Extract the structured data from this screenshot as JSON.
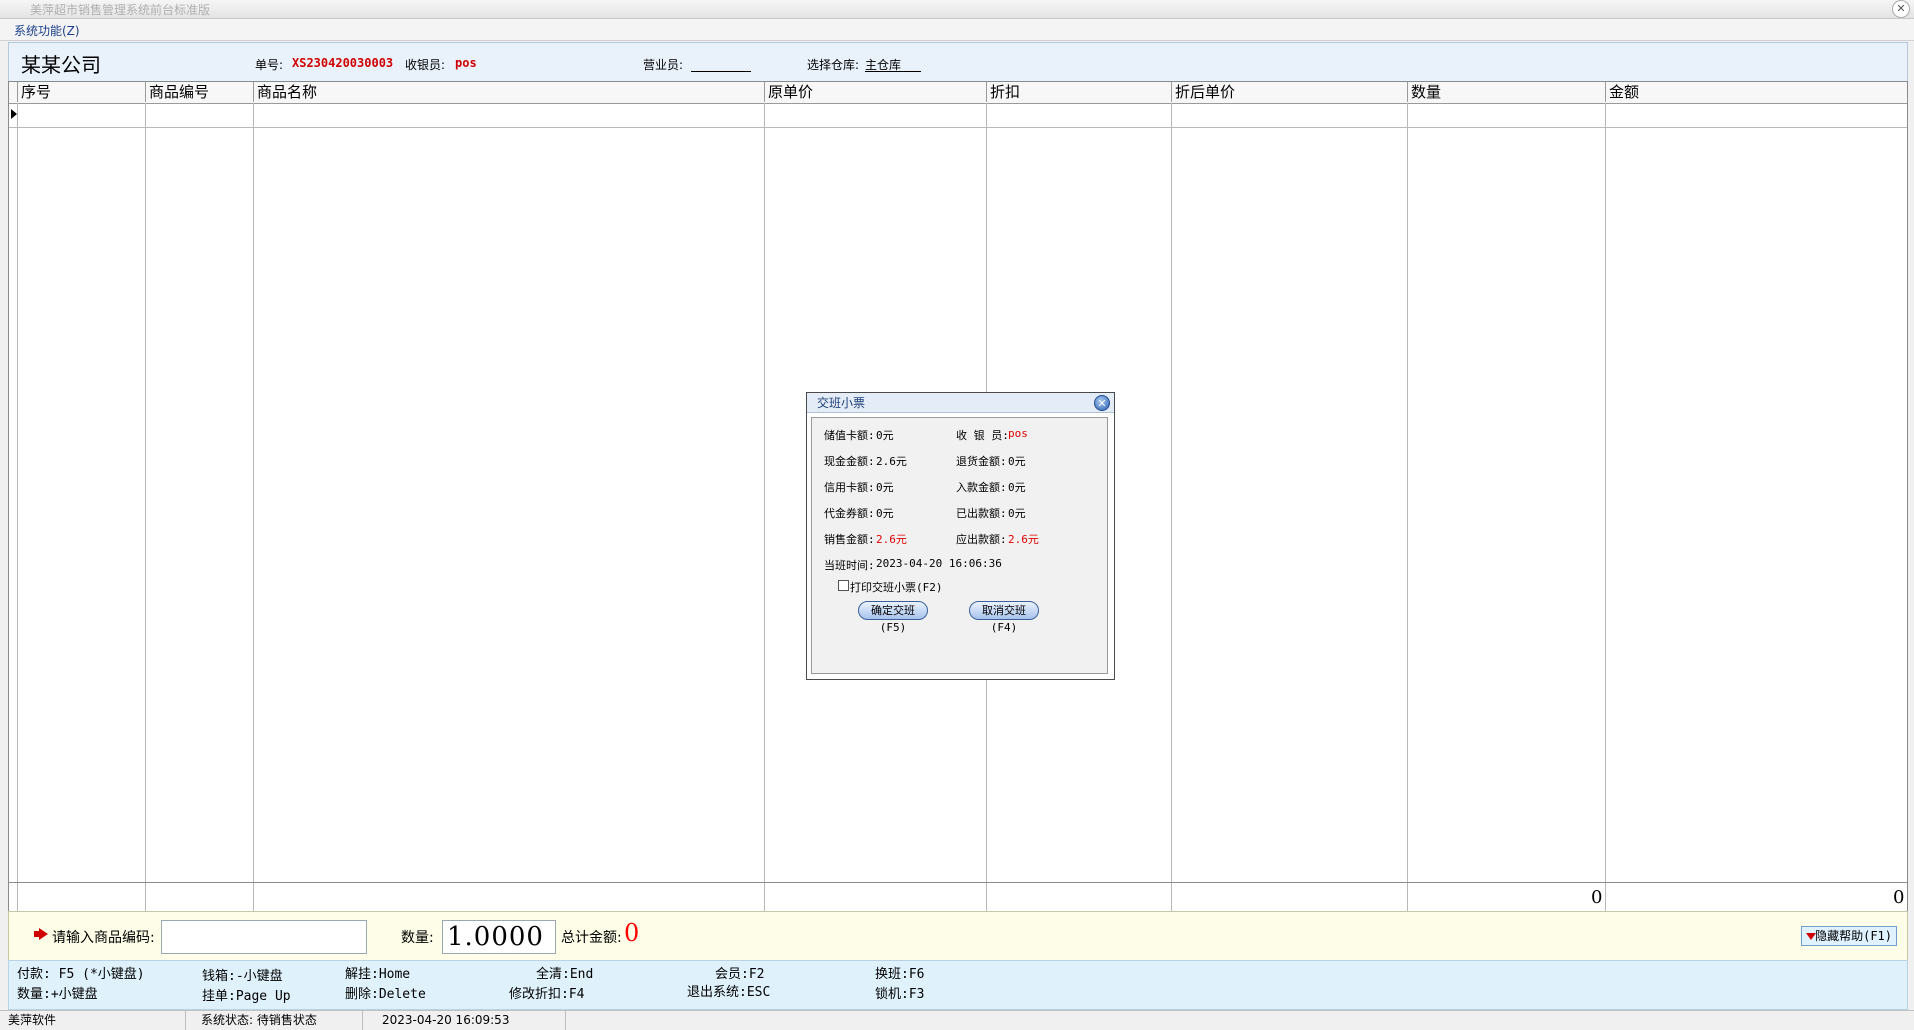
{
  "window": {
    "title": "美萍超市销售管理系统前台标准版",
    "close_glyph": "✕"
  },
  "menu": {
    "system_label": "系统功能(Z)"
  },
  "header": {
    "company": "某某公司",
    "order_label": "单号:",
    "order_value": "XS230420030003",
    "cashier_label": "收银员:",
    "cashier_value": "pos",
    "salesperson_label": "营业员:",
    "salesperson_value": "",
    "warehouse_label": "选择仓库:",
    "warehouse_value": "主仓库"
  },
  "table": {
    "columns": [
      "序号",
      "商品编号",
      "商品名称",
      "原单价",
      "折扣",
      "折后单价",
      "数量",
      "金额"
    ],
    "rows": [],
    "totals": {
      "quantity": "0",
      "amount": "0"
    }
  },
  "input_bar": {
    "barcode_label": "请输入商品编码:",
    "barcode_value": "",
    "quantity_label": "数量:",
    "quantity_value": "1.0000",
    "total_label": "总计金额:",
    "total_value": "0",
    "hide_help_label": "隐藏帮助(F1)"
  },
  "shortcuts": [
    {
      "text": "付款: F5 (*小键盘)"
    },
    {
      "text": "数量:+小键盘"
    },
    {
      "text": "钱箱:-小键盘"
    },
    {
      "text": "挂单:Page Up"
    },
    {
      "text": "解挂:Home"
    },
    {
      "text": "删除:Delete"
    },
    {
      "text": "全清:End"
    },
    {
      "text": "修改折扣:F4"
    },
    {
      "text": "会员:F2"
    },
    {
      "text": "退出系统:ESC"
    },
    {
      "text": "换班:F6"
    },
    {
      "text": "锁机:F3"
    }
  ],
  "status_bar": {
    "vendor": "美萍软件",
    "status": "系统状态: 待销售状态",
    "datetime": "2023-04-20 16:09:53"
  },
  "dialog": {
    "title": "交班小票",
    "fields": {
      "stored_card_label": "储值卡额:",
      "stored_card_value": "0元",
      "cashier_label": "收 银 员:",
      "cashier_value": "pos",
      "cash_label": "现金金额:",
      "cash_value": "2.6元",
      "refund_label": "退货金额:",
      "refund_value": "0元",
      "credit_label": "信用卡额:",
      "credit_value": "0元",
      "deposit_label": "入款金额:",
      "deposit_value": "0元",
      "voucher_label": "代金券额:",
      "voucher_value": "0元",
      "paid_out_label": "已出款额:",
      "paid_out_value": "0元",
      "sales_label": "销售金额:",
      "sales_value": "2.6元",
      "due_label": "应出款额:",
      "due_value": "2.6元",
      "shift_time_label": "当班时间:",
      "shift_time_value": "2023-04-20 16:06:36"
    },
    "print_checkbox_label": "打印交班小票(F2)",
    "print_checked": false,
    "confirm_label": "确定交班(F5)",
    "cancel_label": "取消交班(F4)"
  },
  "colors": {
    "accent_red": "#e00000",
    "header_bg": "#e9f1fb",
    "help_bg": "#dff1fb",
    "input_bg": "#fdfde8"
  }
}
